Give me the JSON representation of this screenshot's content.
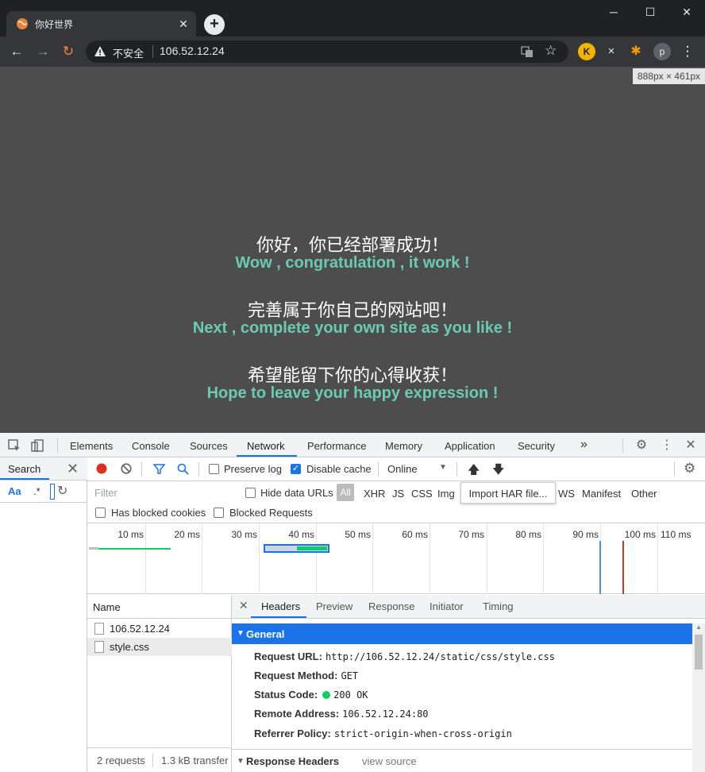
{
  "browser": {
    "tab_title": "你好世界",
    "tab_close": "✕",
    "new_tab": "+",
    "window_controls": {
      "minimize": "─",
      "maximize": "☐",
      "close": "✕"
    },
    "nav": {
      "back": "←",
      "forward": "→",
      "reload": "↻"
    },
    "security_label": "不安全",
    "url": "106.52.12.24",
    "bookmark_star": "☆",
    "extensions": [
      {
        "icon": "extension-k-icon",
        "glyph": "K",
        "color": "#f1b300"
      },
      {
        "icon": "extension-x-icon",
        "glyph": "✕",
        "color": "#202124"
      },
      {
        "icon": "puzzle-icon",
        "glyph": "✱",
        "color": "#f29900"
      },
      {
        "icon": "profile-avatar",
        "glyph": "p",
        "color": "#5f6368"
      }
    ],
    "menu": "⋮"
  },
  "page": {
    "size_badge": "888px × 461px",
    "lines": [
      {
        "cn": "你好，你已经部署成功！",
        "en": "Wow , congratulation , it work !"
      },
      {
        "cn": "完善属于你自己的网站吧！",
        "en": "Next , complete your own site as you like !"
      },
      {
        "cn": "希望能留下你的心得收获！",
        "en": "Hope to leave your happy expression !"
      }
    ],
    "colors": {
      "background": "#4d4d4d",
      "accent": "#6bcab4"
    }
  },
  "devtools": {
    "tabs": [
      "Elements",
      "Console",
      "Sources",
      "Network",
      "Performance",
      "Memory",
      "Application",
      "Security"
    ],
    "active_tab": "Network",
    "more_tabs": "»",
    "search": {
      "label": "Search",
      "case_toggle": "Aa",
      "regex_toggle": ".*"
    },
    "network_toolbar": {
      "preserve_log": "Preserve log",
      "preserve_log_checked": false,
      "disable_cache": "Disable cache",
      "disable_cache_checked": true,
      "throttling": "Online"
    },
    "filter": {
      "placeholder": "Filter",
      "hide_data_urls": "Hide data URLs",
      "types": [
        "All",
        "XHR",
        "JS",
        "CSS",
        "Img",
        "WS",
        "Manifest",
        "Other"
      ],
      "tooltip": "Import HAR file...",
      "has_blocked_cookies": "Has blocked cookies",
      "blocked_requests": "Blocked Requests"
    },
    "timeline_ticks": [
      "10 ms",
      "20 ms",
      "30 ms",
      "40 ms",
      "50 ms",
      "60 ms",
      "70 ms",
      "80 ms",
      "90 ms",
      "100 ms",
      "110 ms"
    ],
    "requests": {
      "column": "Name",
      "rows": [
        "106.52.12.24",
        "style.css"
      ],
      "selected": "style.css",
      "footer_count": "2 requests",
      "footer_transfer": "1.3 kB transfer"
    },
    "details": {
      "close": "✕",
      "tabs": [
        "Headers",
        "Preview",
        "Response",
        "Initiator",
        "Timing"
      ],
      "active_tab": "Headers",
      "general_title": "General",
      "general": [
        {
          "key": "Request URL:",
          "value": "http://106.52.12.24/static/css/style.css"
        },
        {
          "key": "Request Method:",
          "value": "GET"
        },
        {
          "key": "Status Code:",
          "value": "200 OK"
        },
        {
          "key": "Remote Address:",
          "value": "106.52.12.24:80"
        },
        {
          "key": "Referrer Policy:",
          "value": "strict-origin-when-cross-origin"
        }
      ],
      "response_headers_title": "Response Headers",
      "view_source": "view source"
    }
  }
}
